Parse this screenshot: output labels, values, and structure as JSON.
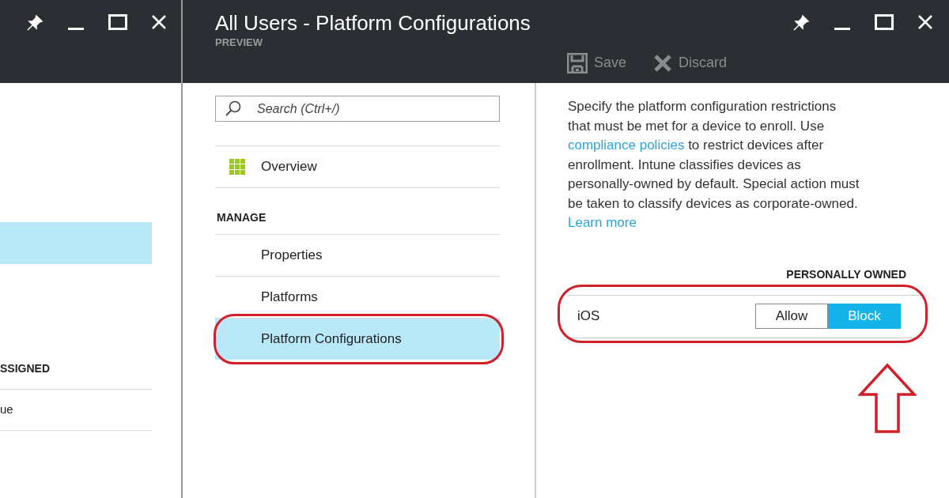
{
  "left_blade": {
    "list_rows": [
      {
        "selected": true
      }
    ],
    "column_header": "SSIGNED",
    "cell": "ue"
  },
  "blade": {
    "title": "All Users - Platform Configurations",
    "subtitle": "PREVIEW",
    "toolbar": [
      {
        "kind": "save",
        "label": "Save"
      },
      {
        "kind": "discard",
        "label": "Discard"
      }
    ],
    "search": {
      "placeholder": "Search (Ctrl+/)"
    },
    "nav": [
      {
        "kind": "overview",
        "label": "Overview",
        "selected": false
      },
      {
        "kind": "section",
        "label": "MANAGE"
      },
      {
        "kind": "item",
        "label": "Properties",
        "selected": false
      },
      {
        "kind": "item",
        "label": "Platforms",
        "selected": false
      },
      {
        "kind": "item",
        "label": "Platform Configurations",
        "selected": true
      }
    ],
    "description": [
      {
        "kind": "text",
        "text": "Specify the platform configuration restrictions that must be met for a device to enroll. Use "
      },
      {
        "kind": "link",
        "text": "compliance policies"
      },
      {
        "kind": "text",
        "text": " to restrict devices after enrollment. Intune classifies devices as personally-owned by default. Special action must be taken to classify devices as corporate-owned. "
      },
      {
        "kind": "link",
        "text": "Learn more"
      }
    ],
    "table": {
      "column": "PERSONALLY OWNED",
      "rows": [
        {
          "platform": "iOS",
          "options": [
            {
              "label": "Allow",
              "selected": false
            },
            {
              "label": "Block",
              "selected": true
            }
          ]
        }
      ]
    }
  }
}
